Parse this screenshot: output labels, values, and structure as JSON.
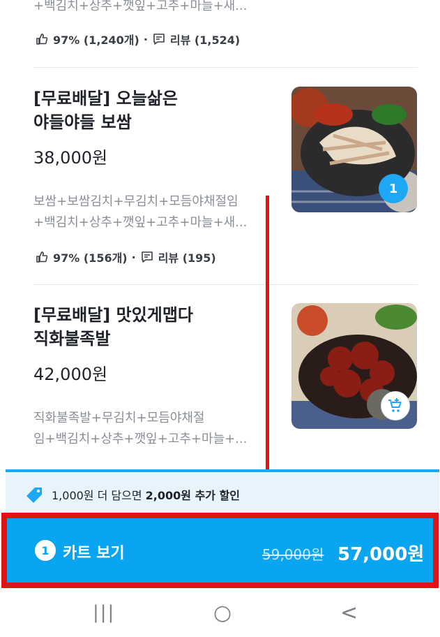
{
  "items": [
    {
      "desc": [
        "+백김치+상추+깻잎+고추+마늘+새..."
      ],
      "rating": "97% (1,240개)",
      "review": "리뷰 (1,524)"
    },
    {
      "title_lines": [
        "[무료배달] 오늘삶은",
        "야들야들 보쌈"
      ],
      "price": "38,000원",
      "desc": [
        "보쌈+보쌈김치+무김치+모듬야채절임",
        "+백김치+상추+깻잎+고추+마늘+새..."
      ],
      "rating": "97% (156개)",
      "review": "리뷰 (195)",
      "qty": "1"
    },
    {
      "title_lines": [
        "[무료배달] 맛있게맵다",
        "직화불족발"
      ],
      "price": "42,000원",
      "desc": [
        "직화불족발+무김치+모듬야채절",
        "임+백김치+상추+깻잎+고추+마늘+..."
      ]
    }
  ],
  "promo": {
    "prefix": "1,000원 더 담으면 ",
    "bold": "2,000원 추가 할인"
  },
  "cart": {
    "count": "1",
    "label": "카트 보기",
    "original_price": "59,000원",
    "final_price": "57,000원"
  },
  "nav": {
    "recent": "|||",
    "home": "○",
    "back": "<"
  },
  "colors": {
    "accent": "#0aa5f0",
    "highlight": "#e01414"
  }
}
